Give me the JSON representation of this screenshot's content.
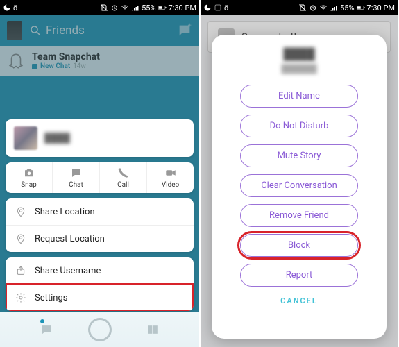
{
  "status": {
    "battery_pct": "55%",
    "time": "7:30 PM"
  },
  "left": {
    "search_placeholder": "Friends",
    "chat_title": "Team Snapchat",
    "chat_status": "New Chat",
    "chat_age": "14w",
    "actions": {
      "snap": "Snap",
      "chat": "Chat",
      "call": "Call",
      "video": "Video"
    },
    "loc": {
      "share": "Share Location",
      "request": "Request Location"
    },
    "more": {
      "share_username": "Share Username",
      "settings": "Settings"
    }
  },
  "right": {
    "bg_card": "Screenshot!",
    "options": {
      "edit_name": "Edit Name",
      "dnd": "Do Not Disturb",
      "mute": "Mute Story",
      "clear": "Clear Conversation",
      "remove": "Remove Friend",
      "block": "Block",
      "report": "Report"
    },
    "cancel": "CANCEL"
  }
}
